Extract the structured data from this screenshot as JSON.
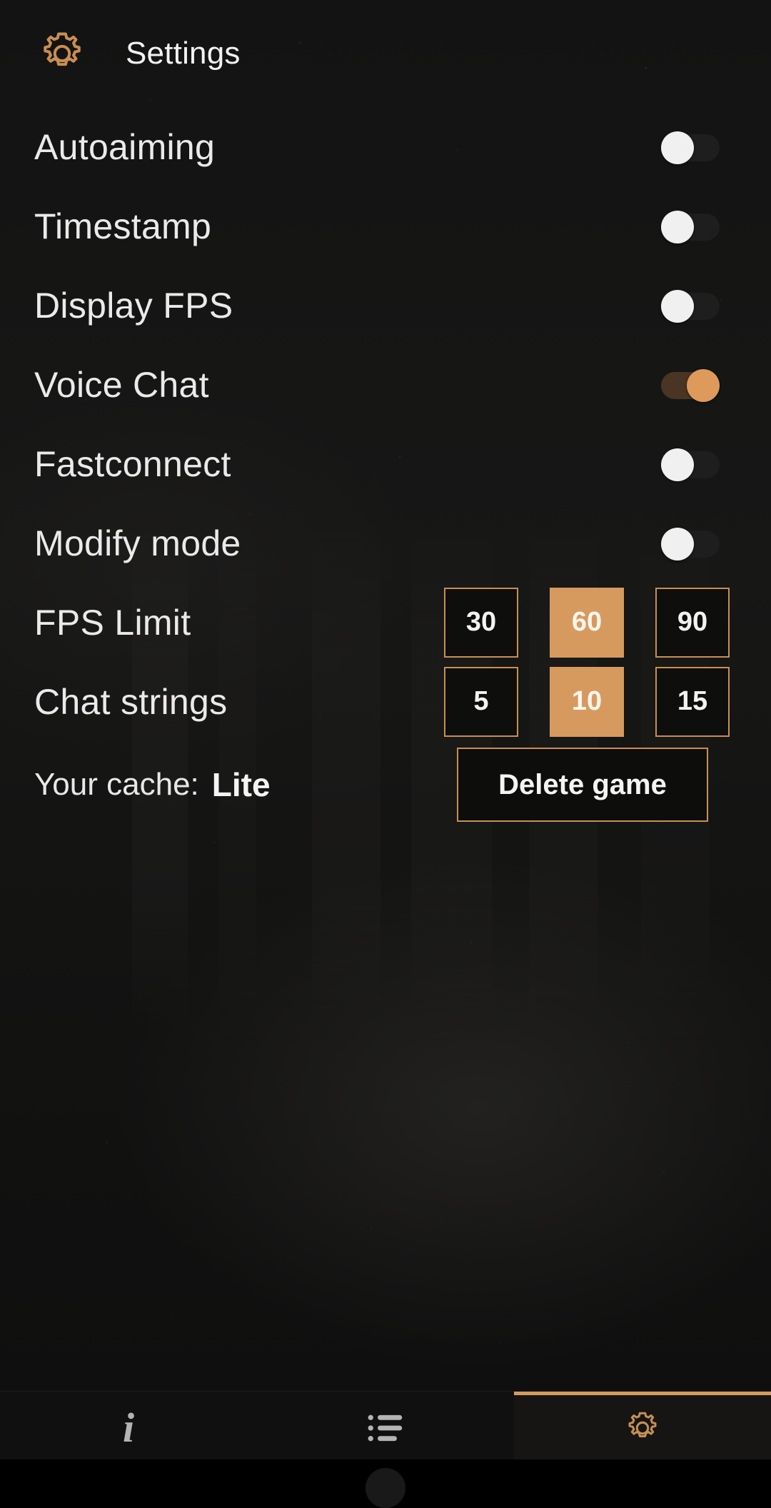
{
  "header": {
    "title": "Settings",
    "icon": "gear-icon",
    "accent_color": "#c98e53"
  },
  "theme": {
    "accent": "#d79a5e",
    "accent_border": "#c98e53",
    "background": "#131313",
    "text": "#eaeaea",
    "toggle_on_knob": "#dd9a5a",
    "toggle_on_track": "#4a3524",
    "toggle_off_knob": "#f0f0f0",
    "toggle_off_track": "#1e1e1e"
  },
  "settings": {
    "toggles": [
      {
        "label": "Autoaiming",
        "value": "off"
      },
      {
        "label": "Timestamp",
        "value": "off"
      },
      {
        "label": "Display FPS",
        "value": "off"
      },
      {
        "label": "Voice Chat",
        "value": "on"
      },
      {
        "label": "Fastconnect",
        "value": "off"
      },
      {
        "label": "Modify mode",
        "value": "off"
      }
    ],
    "option_rows": [
      {
        "label": "FPS Limit",
        "options": [
          "30",
          "60",
          "90"
        ],
        "selected": "60"
      },
      {
        "label": "Chat strings",
        "options": [
          "5",
          "10",
          "15"
        ],
        "selected": "10"
      }
    ],
    "cache": {
      "label": "Your cache:",
      "value": "Lite",
      "delete_button": "Delete game"
    }
  },
  "bottom_nav": {
    "items": [
      {
        "label": "Information",
        "icon": "info-icon",
        "active": false
      },
      {
        "label": "Servers",
        "icon": "list-icon",
        "active": false
      },
      {
        "label": "Settings",
        "icon": "gear-icon",
        "active": true
      }
    ]
  }
}
